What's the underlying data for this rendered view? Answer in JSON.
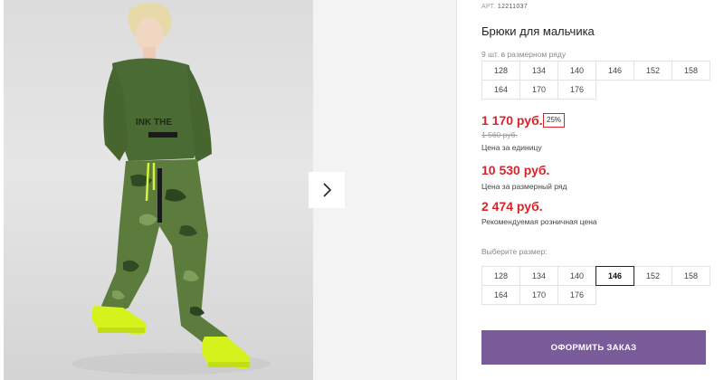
{
  "product": {
    "sku_label": "АРТ.",
    "sku_value": "12211037",
    "title": "Брюки для мальчика",
    "pack_label": "9 шт. в размерном ряду"
  },
  "pack_sizes": [
    "128",
    "134",
    "140",
    "146",
    "152",
    "158",
    "164",
    "170",
    "176"
  ],
  "prices": {
    "unit_price": "1 170 руб.",
    "discount": "25%",
    "old_price": "1 560 руб.",
    "unit_caption": "Цена за единицу",
    "pack_price": "10 530 руб.",
    "pack_caption": "Цена за размерный ряд",
    "rrp_price": "2 474 руб.",
    "rrp_caption": "Рекомендуемая розничная цена"
  },
  "size_select": {
    "label": "Выберите размер:",
    "sizes": [
      "128",
      "134",
      "140",
      "146",
      "152",
      "158",
      "164",
      "170",
      "176"
    ],
    "selected": "146"
  },
  "order_button": {
    "label": "ОФОРМИТЬ ЗАКАЗ"
  },
  "colors": {
    "price_red": "#d8232a",
    "button_purple": "#7b5c9b"
  },
  "icons": {
    "next": "chevron-right-icon"
  }
}
